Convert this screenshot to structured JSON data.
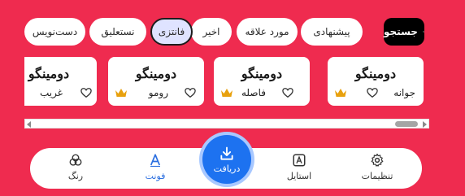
{
  "chips": [
    {
      "label": "جستجو",
      "icon": "search-icon"
    },
    {
      "label": "پیشنهادی"
    },
    {
      "label": "مورد علاقه"
    },
    {
      "label": "اخیر"
    },
    {
      "label": "فانتزی",
      "selected": true
    },
    {
      "label": "نستعلیق"
    },
    {
      "label": "دست‌نویس"
    }
  ],
  "cards": [
    {
      "sample": "دومینگو",
      "name": "جوانه",
      "premium": true
    },
    {
      "sample": "دومینگو",
      "name": "فاصله",
      "premium": true
    },
    {
      "sample": "دومینگو",
      "name": "رومو",
      "premium": true
    },
    {
      "sample": "دومینگو",
      "name": "غریب",
      "premium": false
    }
  ],
  "nav": {
    "settings": "تنظیمات",
    "style": "استایل",
    "download": "دریافت",
    "font": "فونت",
    "color": "رنگ"
  },
  "colors": {
    "background": "#ef2b4f",
    "accent": "#1d72f0",
    "crown": "#e8a10e"
  }
}
